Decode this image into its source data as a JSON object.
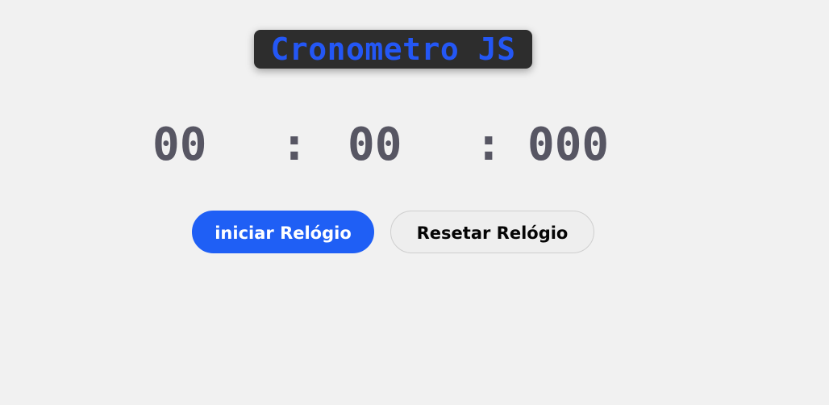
{
  "title": "Cronometro JS",
  "timer": {
    "minutes": "00",
    "separator_1": ":",
    "seconds": "00",
    "separator_2": ":",
    "milliseconds": "000"
  },
  "buttons": {
    "start": "iniciar Relógio",
    "reset": "Resetar Relógio"
  },
  "colors": {
    "background": "#f1f1f1",
    "title_background": "#2d2d2d",
    "title_text": "#2457f5",
    "timer_text": "#575663",
    "start_button": "#1f5ff5",
    "reset_button": "#eeeeee"
  }
}
